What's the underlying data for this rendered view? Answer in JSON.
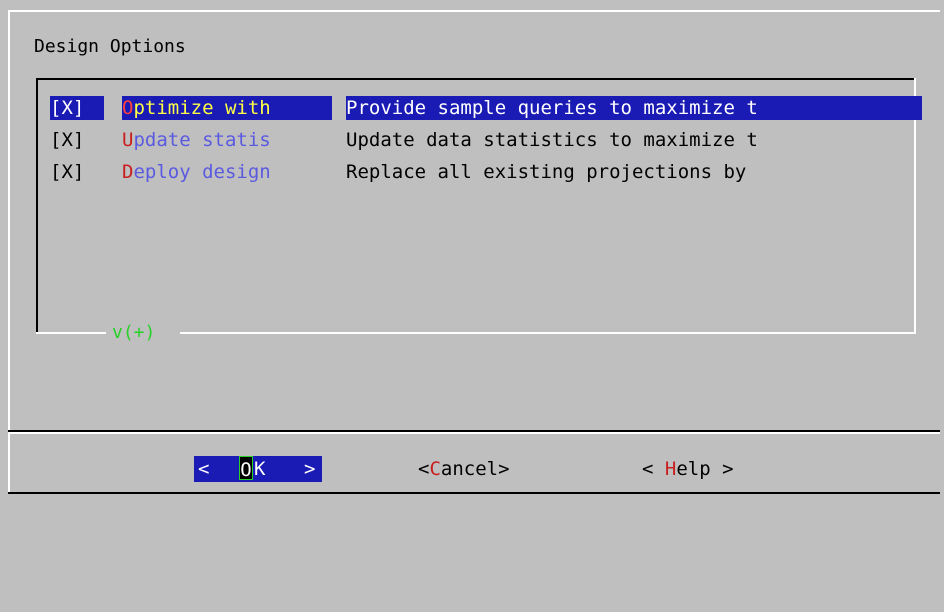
{
  "dialog": {
    "title": "Design Options"
  },
  "options": [
    {
      "checkbox": "[X]",
      "tag_hotkey": "O",
      "tag_rest": "ptimize with",
      "description": "Provide sample queries to maximize t",
      "selected": true
    },
    {
      "checkbox": "[X]",
      "tag_hotkey": "U",
      "tag_rest": "pdate statis",
      "description": "Update data statistics to maximize t",
      "selected": false
    },
    {
      "checkbox": "[X]",
      "tag_hotkey": "D",
      "tag_rest": "eploy design",
      "description": "Replace all existing projections by",
      "selected": false
    }
  ],
  "scroll_indicator": "v(+)",
  "buttons": {
    "ok": {
      "left_bracket": "<",
      "hotkey": "O",
      "rest": "K",
      "right_bracket": ">"
    },
    "cancel": {
      "prefix": "<",
      "hotkey": "C",
      "rest": "ancel>"
    },
    "help": {
      "prefix": "< ",
      "hotkey": "H",
      "rest": "elp >"
    }
  },
  "colors": {
    "background": "#c0bfc0",
    "selection": "#1a1ab4",
    "hotkey": "#c81e1e",
    "tag_text": "#5a5ae0",
    "selected_tag_text": "#ffff46",
    "scroll_indicator": "#28d028"
  }
}
